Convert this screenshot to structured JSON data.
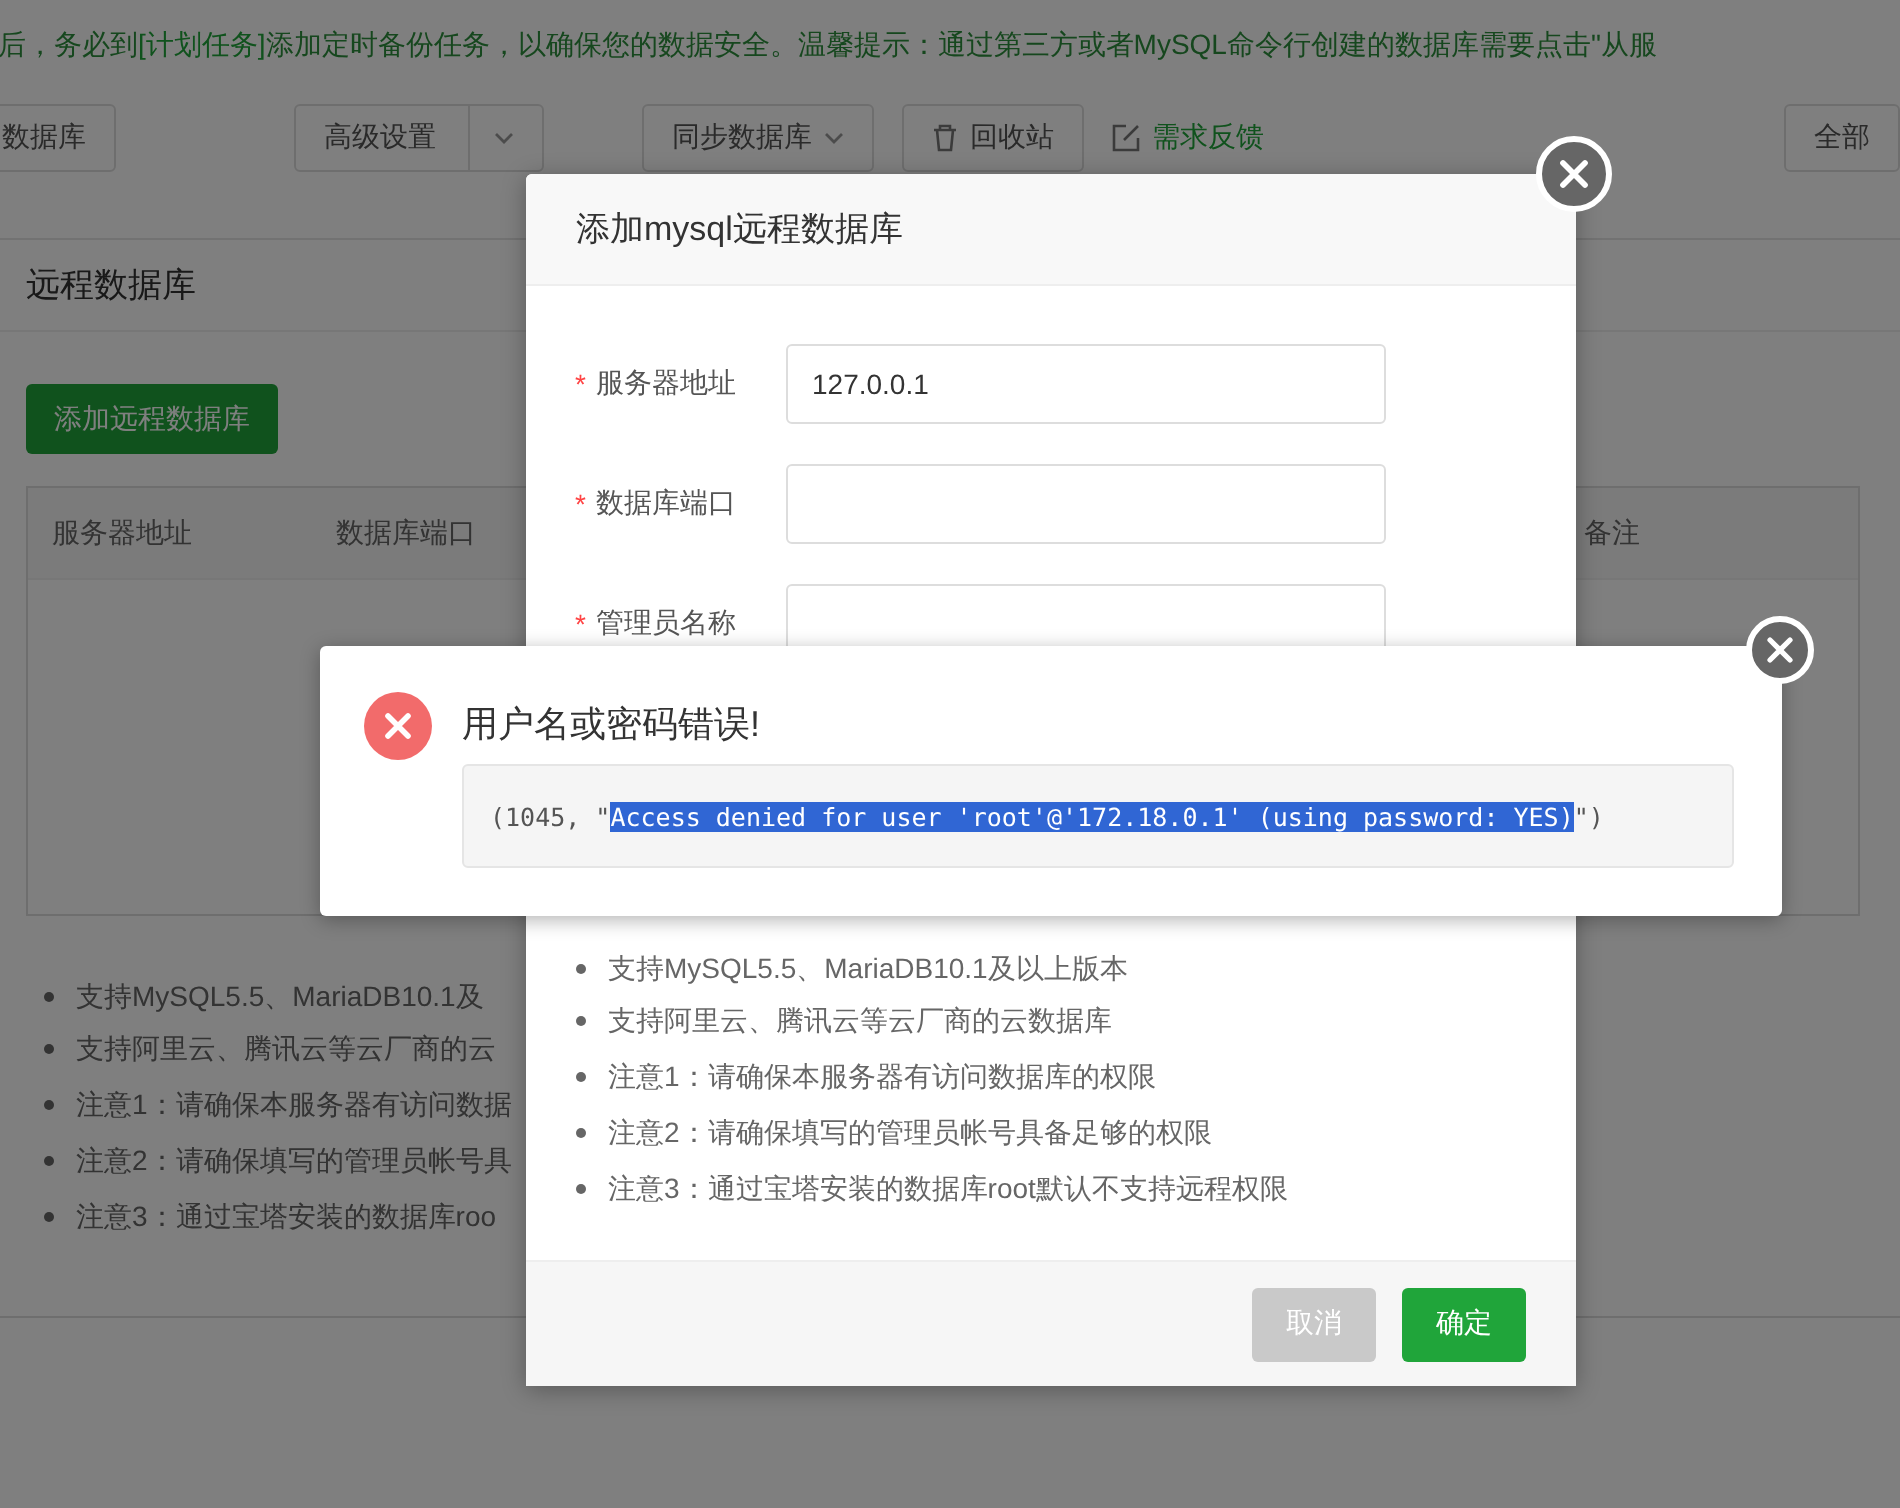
{
  "banner": {
    "segments": [
      {
        "text": "后，务必到",
        "kind": "plain"
      },
      {
        "text": "[计划任务]",
        "kind": "link"
      },
      {
        "text": "添加定时备份任务，以确保您的数据安全。温馨提示：通过第三方或者MySQL命令行创建的数据库需要点击\"从服",
        "kind": "plain"
      }
    ]
  },
  "toolbar": [
    {
      "label": "数据库",
      "kind": "button"
    },
    {
      "label": "高级设置",
      "kind": "split"
    },
    {
      "label": "同步数据库",
      "kind": "dropdown"
    },
    {
      "label": "回收站",
      "kind": "trash"
    },
    {
      "label": "需求反馈",
      "kind": "feedback"
    },
    {
      "label": "全部",
      "kind": "button"
    }
  ],
  "panel": {
    "title": "远程数据库",
    "add_button": "添加远程数据库",
    "columns": [
      "服务器地址",
      "数据库端口",
      "备注"
    ],
    "notes": [
      "支持MySQL5.5、MariaDB10.1及",
      "支持阿里云、腾讯云等云厂商的云",
      "注意1：请确保本服务器有访问数据",
      "注意2：请确保填写的管理员帐号具",
      "注意3：通过宝塔安装的数据库roo"
    ]
  },
  "modal": {
    "title": "添加mysql远程数据库",
    "fields": [
      {
        "label": "服务器地址",
        "marker": "*",
        "value": "127.0.0.1"
      },
      {
        "label": "数据库端口",
        "marker": "*"
      },
      {
        "label": "管理员名称",
        "marker": "*"
      }
    ],
    "notes": [
      "支持MySQL5.5、MariaDB10.1及以上版本",
      "支持阿里云、腾讯云等云厂商的云数据库",
      "注意1：请确保本服务器有访问数据库的权限",
      "注意2：请确保填写的管理员帐号具备足够的权限",
      "注意3：通过宝塔安装的数据库root默认不支持远程权限"
    ],
    "buttons": [
      {
        "label": "取消",
        "kind": "cancel"
      },
      {
        "label": "确定",
        "kind": "confirm"
      }
    ]
  },
  "error": {
    "title": "用户名或密码错误!",
    "detail": [
      {
        "text": "(1045, \"",
        "selected": false
      },
      {
        "text": "Access denied for user 'root'@'172.18.0.1' (using password: YES)",
        "selected": true
      },
      {
        "text": "\")",
        "selected": false
      }
    ]
  }
}
